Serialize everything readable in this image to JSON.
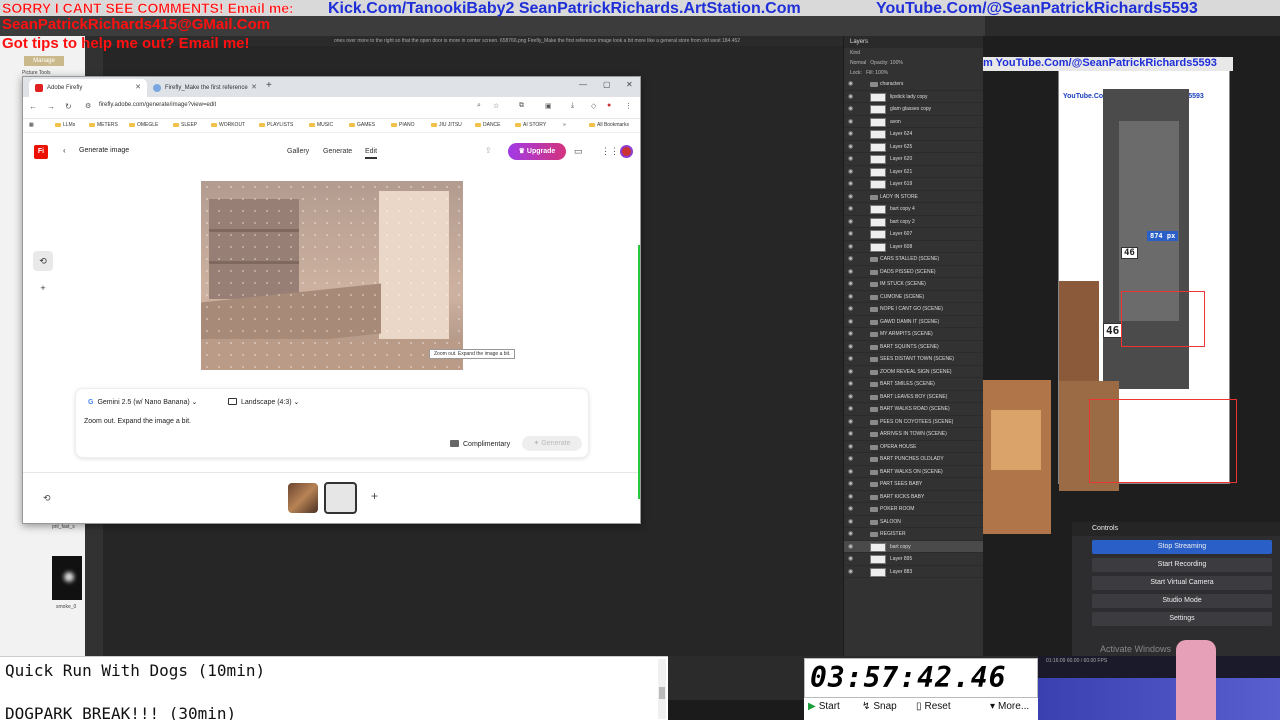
{
  "overlay": {
    "line1": "SORRY I CANT SEE COMMENTS! Email me:",
    "line2": "SeanPatrickRichards415@GMail.Com",
    "line3": "Got tips to help me out? Email me!",
    "kick": "Kick.Com/TanookiBaby2 SeanPatrickRichards.ArtStation.Com",
    "youtube": "YouTube.Com/@SeanPatrickRichards5593",
    "youtube_right": "m YouTube.Com/@SeanPatrickRichards5593"
  },
  "background": {
    "ps_tabs_text": "ones over more to the right so that the open door is more in center screen. 658766.png   Firefly_Make the first reference image look a bit more like a general store from old west 184.452",
    "manage_label": "Manage",
    "picture_tools_label": "Picture Tools",
    "smoke_label": "smoke_0",
    "pnl_label": "pnl_fast_s"
  },
  "layers_panel": {
    "title": "Layers",
    "kind_label": "Kind",
    "blend_mode": "Normal",
    "opacity_label": "Opacity: 100%",
    "lock_label": "Lock:",
    "fill_label": "Fill: 100%",
    "layers": [
      {
        "name": "characters",
        "type": "folder"
      },
      {
        "name": "lipstick lady copy",
        "type": "layer"
      },
      {
        "name": "glam glasses copy",
        "type": "layer"
      },
      {
        "name": "avon",
        "type": "layer"
      },
      {
        "name": "Layer 624",
        "type": "layer"
      },
      {
        "name": "Layer 625",
        "type": "layer"
      },
      {
        "name": "Layer 620",
        "type": "layer"
      },
      {
        "name": "Layer 621",
        "type": "layer"
      },
      {
        "name": "Layer 619",
        "type": "layer"
      },
      {
        "name": "LADY IN STORE",
        "type": "folder"
      },
      {
        "name": "bart copy 4",
        "type": "layer"
      },
      {
        "name": "bart copy 2",
        "type": "layer"
      },
      {
        "name": "Layer 607",
        "type": "layer"
      },
      {
        "name": "Layer 608",
        "type": "layer"
      },
      {
        "name": "CARS STALLED (SCENE)",
        "type": "folder"
      },
      {
        "name": "DADS PISSED (SCENE)",
        "type": "folder"
      },
      {
        "name": "IM STUCK (SCENE)",
        "type": "folder"
      },
      {
        "name": "CUMONE (SCENE)",
        "type": "folder"
      },
      {
        "name": "NOPE I CANT GO (SCENE)",
        "type": "folder"
      },
      {
        "name": "GAWD DAMN IT (SCENE)",
        "type": "folder"
      },
      {
        "name": "MY ARMPITS (SCENE)",
        "type": "folder"
      },
      {
        "name": "BART SQUINTS (SCENE)",
        "type": "folder"
      },
      {
        "name": "SEES DISTANT TOWN (SCENE)",
        "type": "folder"
      },
      {
        "name": "ZOOM REVEAL SIGN (SCENE)",
        "type": "folder"
      },
      {
        "name": "BART SMILES (SCENE)",
        "type": "folder"
      },
      {
        "name": "BART LEAVES BOY (SCENE)",
        "type": "folder"
      },
      {
        "name": "BART WALKS ROAD (SCENE)",
        "type": "folder"
      },
      {
        "name": "PEES ON COYOTEES (SCENE)",
        "type": "folder"
      },
      {
        "name": "ARRIVES IN TOWN (SCENE)",
        "type": "folder"
      },
      {
        "name": "OPERA HOUSE",
        "type": "folder"
      },
      {
        "name": "BART PUNCHES OLDLADY",
        "type": "folder"
      },
      {
        "name": "BART WALKS ON (SCENE)",
        "type": "folder"
      },
      {
        "name": "PART SEES BABY",
        "type": "folder"
      },
      {
        "name": "BART KICKS BABY",
        "type": "folder"
      },
      {
        "name": "POKER ROOM",
        "type": "folder"
      },
      {
        "name": "SALOON",
        "type": "folder"
      },
      {
        "name": "REGISTER",
        "type": "folder"
      },
      {
        "name": "bart copy",
        "type": "layer"
      },
      {
        "name": "Layer 895",
        "type": "layer"
      },
      {
        "name": "Layer 883",
        "type": "layer"
      }
    ]
  },
  "obs": {
    "preview_number_1": "46",
    "preview_number_2": "874 px",
    "preview_number_3": "46",
    "controls_title": "Controls",
    "stop_streaming": "Stop Streaming",
    "start_recording": "Start Recording",
    "start_virtual_camera": "Start Virtual Camera",
    "studio_mode": "Studio Mode",
    "settings": "Settings",
    "activate_windows": "Activate Windows",
    "status": "01:16:09  60.00 / 60.00 FPS",
    "kbps": "kbps"
  },
  "browser": {
    "tabs": [
      {
        "label": "Adobe Firefly",
        "active": true
      },
      {
        "label": "Firefly_Make the first reference",
        "active": false
      }
    ],
    "url": "firefly.adobe.com/generate/image?view=edit",
    "bookmarks": [
      "LLMs",
      "METERS",
      "OMEGLE",
      "SLEEP",
      "WORKOUT",
      "PLAYLISTS",
      "MUSIC",
      "GAMES",
      "PIANO",
      "JIU JITSU",
      "DANCE",
      "AI STORY"
    ],
    "all_bookmarks": "All Bookmarks"
  },
  "firefly": {
    "logo": "Fi",
    "page_title": "Generate image",
    "nav": [
      "Gallery",
      "Generate",
      "Edit"
    ],
    "active_nav": "Edit",
    "upgrade_label": "Upgrade",
    "tooltip": "Zoom out. Expand the image a bit.",
    "model": "Gemini 2.5 (w/ Nano Banana)",
    "aspect": "Landscape (4:3)",
    "prompt": "Zoom out. Expand the image a bit.",
    "complimentary": "Complimentary",
    "generate": "Generate"
  },
  "tasks": {
    "task1": "Quick Run With Dogs (10min)",
    "task2": "DOGPARK BREAK!!! (30min)"
  },
  "timer": {
    "value": "03:57:42.46",
    "start": "Start",
    "snap": "Snap",
    "reset": "Reset",
    "more": "More..."
  }
}
